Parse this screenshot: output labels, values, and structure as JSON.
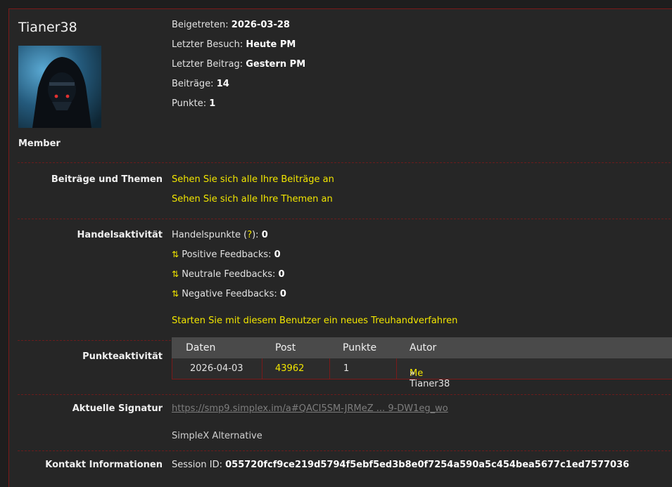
{
  "profile": {
    "username": "Tianer38",
    "role": "Member",
    "joined_label": "Beigetreten:",
    "joined_value": "2026-03-28",
    "last_visit_label": "Letzter Besuch:",
    "last_visit_value": "Heute PM",
    "last_post_label": "Letzter Beitrag:",
    "last_post_value": "Gestern PM",
    "posts_label": "Beiträge:",
    "posts_value": "14",
    "points_label": "Punkte:",
    "points_value": "1"
  },
  "posts_topics": {
    "label": "Beiträge und Themen",
    "view_posts": "Sehen Sie sich alle Ihre Beiträge an",
    "view_topics": "Sehen Sie sich alle Ihre Themen an"
  },
  "trade": {
    "label": "Handelsaktivität",
    "trade_points_label": "Handelspunkte (",
    "trade_points_q": "?",
    "trade_points_close": "):",
    "trade_points_value": "0",
    "arrow_glyph": "⇅",
    "positive_label": "Positive Feedbacks:",
    "positive_value": "0",
    "neutral_label": "Neutrale Feedbacks:",
    "neutral_value": "0",
    "negative_label": "Negative Feedbacks:",
    "negative_value": "0",
    "escrow_link": "Starten Sie mit diesem Benutzer ein neues Treuhandverfahren"
  },
  "points_activity": {
    "label": "Punkteaktivität",
    "columns": [
      "Daten",
      "Post",
      "Punkte",
      "Autor"
    ],
    "rows": [
      {
        "date": "2026-04-03",
        "post": "43962",
        "points": "1",
        "author_link": "Me",
        "author_rest": " » Tianer38"
      }
    ]
  },
  "signature": {
    "label": "Aktuelle Signatur",
    "url": "https://smp9.simplex.im/a#QACI5SM-JRMeZ ... 9-DW1eg_wo",
    "text": "SimpleX Alternative"
  },
  "contact": {
    "label": "Kontakt Informationen",
    "session_label": "Session ID:",
    "session_value": "055720fcf9ce219d5794f5ebf5ed3b8e0f7254a590a5c454bea5677c1ed7577036"
  },
  "colors": {
    "background": "#262626",
    "link": "#f2e600",
    "separator": "#6a1c1c",
    "table_header": "#4a4a4a"
  }
}
